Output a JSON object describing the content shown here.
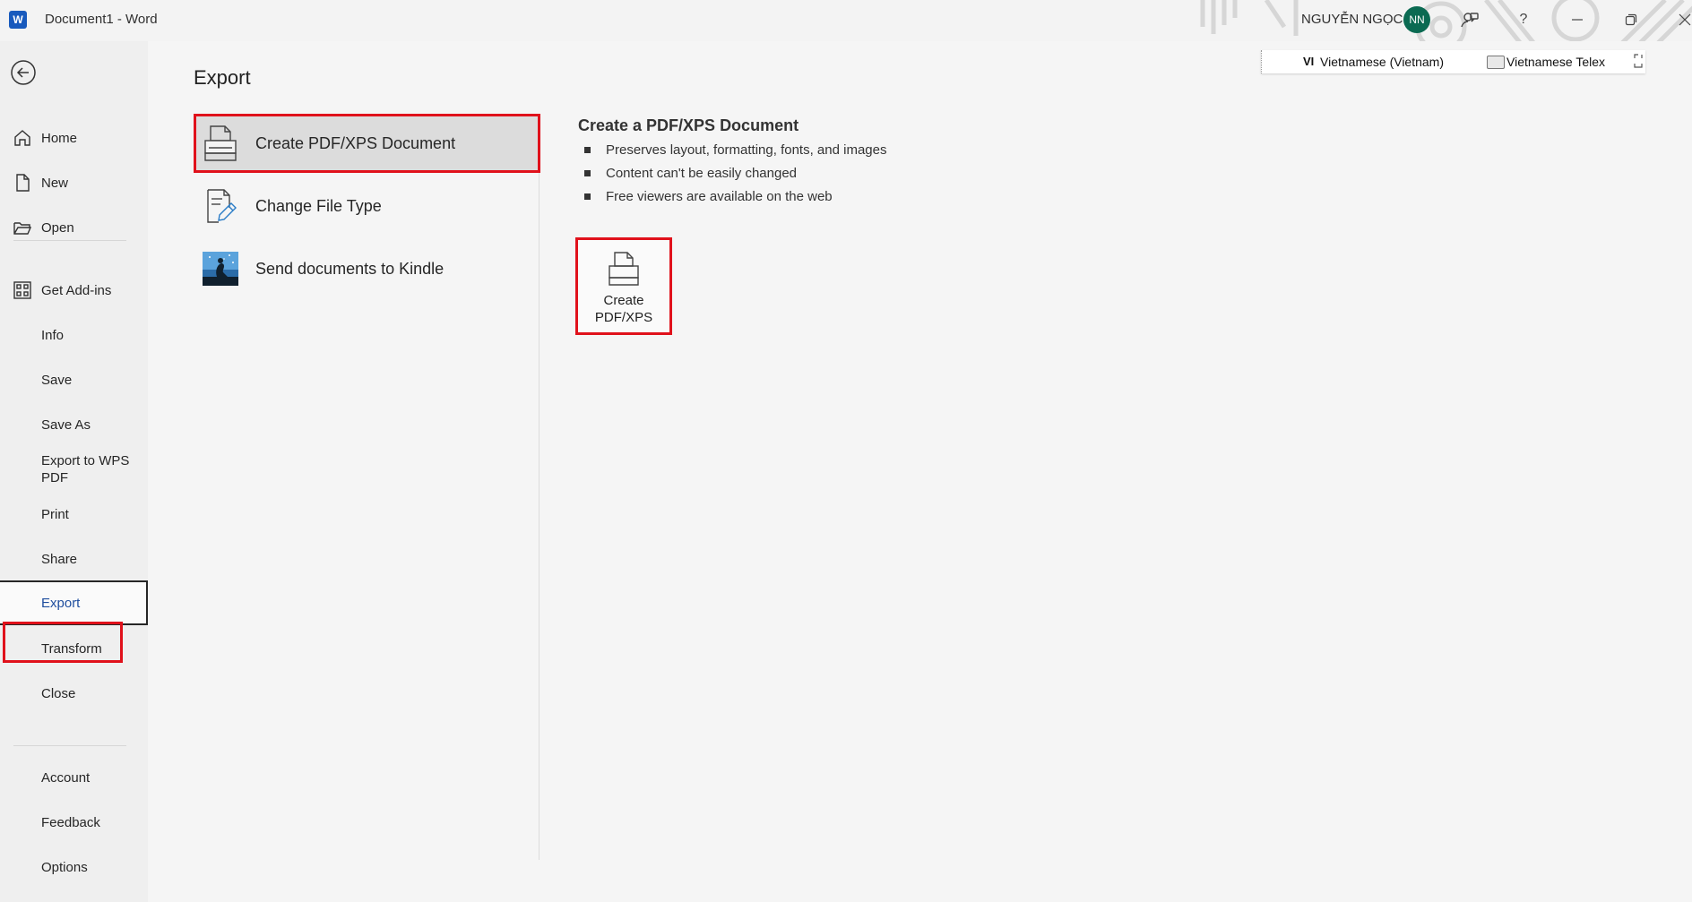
{
  "titlebar": {
    "app_logo": "W",
    "window_title": "Document1  -  Word",
    "user_name": "NGUYỄN NGỌC",
    "user_initials": "NN",
    "icons": [
      "coauthor-icon",
      "help-icon",
      "minimize-icon",
      "restore-icon",
      "close-icon"
    ]
  },
  "language_bar": {
    "code": "VI",
    "language": "Vietnamese (Vietnam)",
    "input_method": "Vietnamese Telex"
  },
  "nav": {
    "top_items": [
      {
        "label": "Home",
        "icon": "home-icon"
      },
      {
        "label": "New",
        "icon": "new-document-icon"
      },
      {
        "label": "Open",
        "icon": "folder-open-icon"
      }
    ],
    "middle_items": [
      {
        "label": "Get Add-ins",
        "icon": "add-ins-icon"
      },
      {
        "label": "Info"
      },
      {
        "label": "Save"
      },
      {
        "label": "Save As"
      },
      {
        "label": "Export to WPS PDF"
      },
      {
        "label": "Print"
      },
      {
        "label": "Share"
      },
      {
        "label": "Export",
        "selected": true
      },
      {
        "label": "Transform"
      },
      {
        "label": "Close"
      }
    ],
    "bottom_items": [
      {
        "label": "Account"
      },
      {
        "label": "Feedback"
      },
      {
        "label": "Options"
      }
    ]
  },
  "main": {
    "title": "Export",
    "options": [
      {
        "label": "Create PDF/XPS Document",
        "icon": "pdf-xps-document-icon",
        "selected": true
      },
      {
        "label": "Change File Type",
        "icon": "change-file-type-icon"
      },
      {
        "label": "Send documents to Kindle",
        "icon": "kindle-icon"
      }
    ],
    "detail": {
      "title": "Create a PDF/XPS Document",
      "bullets": [
        "Preserves layout, formatting, fonts, and images",
        "Content can't be easily changed",
        "Free viewers are available on the web"
      ],
      "button_label": "Create PDF/XPS"
    }
  },
  "colors": {
    "highlight": "#e0111b",
    "selected_text": "#1f4e9e",
    "avatar_bg": "#0b6a52",
    "word_blue": "#185abd"
  }
}
